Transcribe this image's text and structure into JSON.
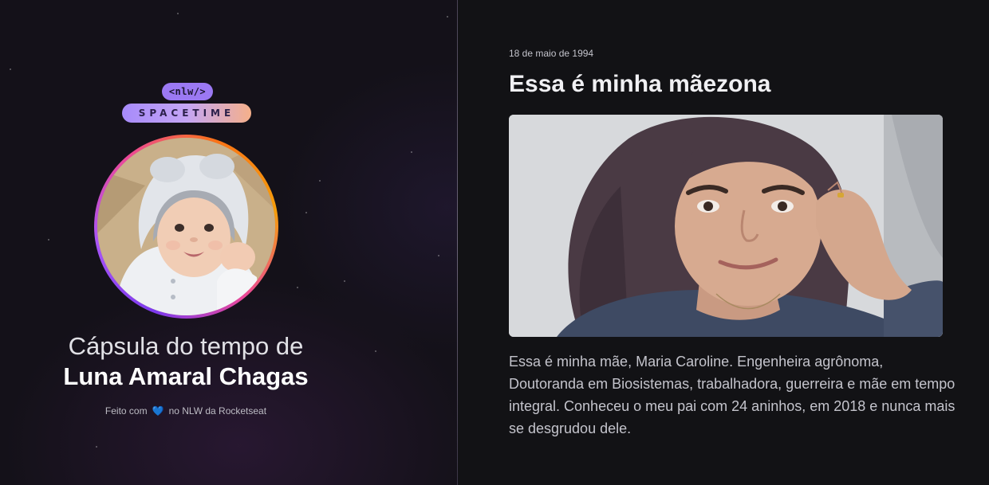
{
  "logo": {
    "top_badge": "<nlw/>",
    "bottom_badge": "SPACETIME"
  },
  "capsule": {
    "title_line1": "Cápsula do tempo de",
    "owner_name": "Luna Amaral Chagas"
  },
  "footer": {
    "prefix": "Feito com",
    "heart": "💙",
    "suffix": "no NLW da Rocketseat"
  },
  "memory": {
    "date": "18 de maio de 1994",
    "title": "Essa é minha mãezona",
    "description": "Essa é minha mãe, Maria Caroline. Engenheira agrônoma, Doutoranda em Biosistemas, trabalhadora, guerreira e mãe em tempo integral. Conheceu o meu pai com 24 aninhos, em 2018 e nunca mais se desgrudou dele."
  },
  "colors": {
    "background": "#121215",
    "accent_purple": "#9b79f3",
    "accent_orange": "#f5b08a",
    "heart_blue": "#3ba3ff"
  }
}
